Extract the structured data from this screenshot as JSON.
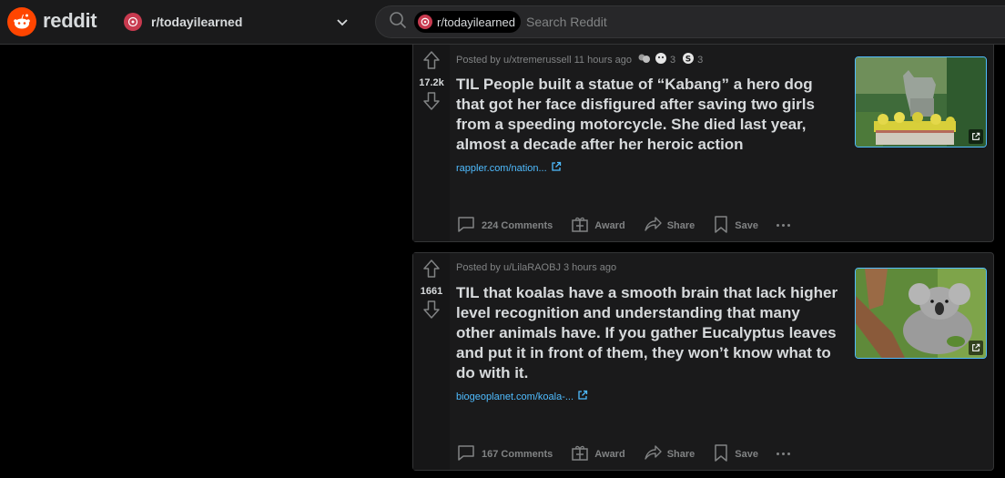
{
  "header": {
    "logo_text": "reddit",
    "community": "r/todayilearned",
    "search_chip": "r/todayilearned",
    "search_placeholder": "Search Reddit"
  },
  "posts": [
    {
      "votes": "17.2k",
      "meta": "Posted by u/xtremerussell 11 hours ago",
      "awards": [
        {
          "icon": "helpful-award-icon",
          "count": ""
        },
        {
          "icon": "wholesome-award-icon",
          "count": "3"
        },
        {
          "icon": "silver-award-icon",
          "count": "3"
        }
      ],
      "title": "TIL People built a statue of “Kabang” a hero dog that got her face disfigured after saving two girls from a speeding motorcycle. She died last year, almost a decade after her heroic action",
      "link": "rappler.com/nation...",
      "thumb": "dog-statue-thumbnail",
      "actions": {
        "comments": "224 Comments",
        "award": "Award",
        "share": "Share",
        "save": "Save"
      }
    },
    {
      "votes": "1661",
      "meta": "Posted by u/LilaRAOBJ 3 hours ago",
      "awards": [],
      "title": "TIL that koalas have a smooth brain that lack higher level recognition and understanding that many other animals have. If you gather Eucalyptus leaves and put it in front of them, they won’t know what to do with it.",
      "link": "biogeoplanet.com/koala-...",
      "thumb": "koala-thumbnail",
      "actions": {
        "comments": "167 Comments",
        "award": "Award",
        "share": "Share",
        "save": "Save"
      }
    }
  ]
}
